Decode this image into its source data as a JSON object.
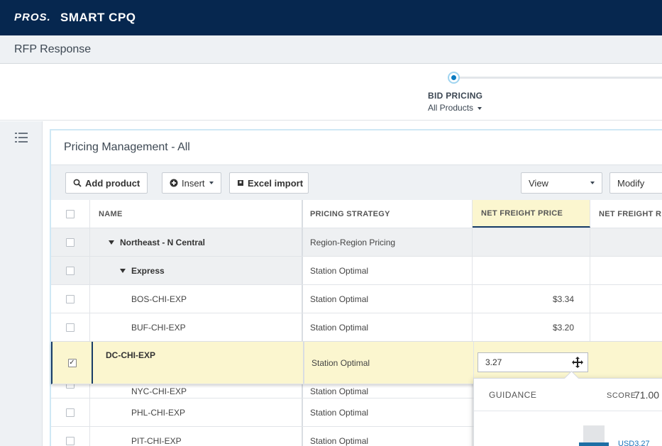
{
  "header": {
    "logo": "PROS.",
    "app_title": "SMART CPQ"
  },
  "subheader": {
    "page_title": "RFP Response"
  },
  "stepper": {
    "step_label": "BID PRICING",
    "step_sub": "All Products"
  },
  "panel": {
    "title": "Pricing Management - All",
    "toolbar": {
      "add_product": "Add product",
      "insert": "Insert",
      "excel_import": "Excel import",
      "view": "View",
      "modify": "Modify"
    }
  },
  "grid": {
    "columns": {
      "name": "NAME",
      "strategy": "PRICING STRATEGY",
      "price": "NET FREIGHT PRICE",
      "rev": "NET FREIGHT REV"
    },
    "rows": [
      {
        "name": "Northeast - N Central",
        "strategy": "Region-Region Pricing",
        "price": ""
      },
      {
        "name": "Express",
        "strategy": "Station Optimal",
        "price": ""
      },
      {
        "name": "BOS-CHI-EXP",
        "strategy": "Station Optimal",
        "price": "$3.34"
      },
      {
        "name": "BUF-CHI-EXP",
        "strategy": "Station Optimal",
        "price": "$3.20"
      },
      {
        "name": "DC-CHI-EXP",
        "strategy": "Station Optimal",
        "price": "3.27",
        "checked": true
      },
      {
        "name": "NYC-CHI-EXP",
        "strategy": "Station Optimal",
        "price": ""
      },
      {
        "name": "PHL-CHI-EXP",
        "strategy": "Station Optimal",
        "price": ""
      },
      {
        "name": "PIT-CHI-EXP",
        "strategy": "Station Optimal",
        "price": ""
      }
    ]
  },
  "guidance": {
    "title": "GUIDANCE",
    "score_label": "SCORE",
    "score": "71.00",
    "value": "USD3.27"
  },
  "colors": {
    "topbar": "#06274f",
    "selected_row": "#fbf6cf",
    "accent": "#0a7bc1"
  }
}
